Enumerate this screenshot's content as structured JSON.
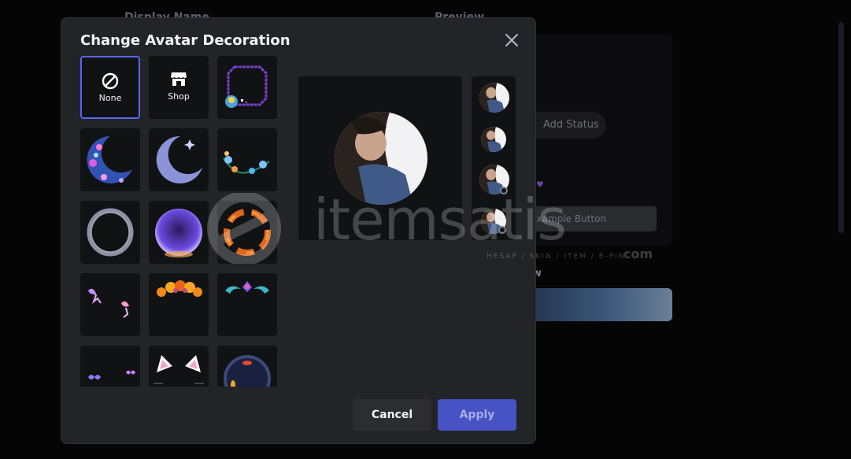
{
  "background": {
    "display_name_label": "Display Name",
    "preview_label": "Preview",
    "add_status": "Add Status",
    "example_button": "Example Button",
    "preview_word": "w"
  },
  "modal": {
    "title": "Change Avatar Decoration",
    "tiles": [
      {
        "name": "none",
        "label": "None",
        "selected": true
      },
      {
        "name": "shop",
        "label": "Shop"
      },
      {
        "name": "pixel-frame",
        "label": ""
      },
      {
        "name": "pink-crescent",
        "label": ""
      },
      {
        "name": "blue-crescent",
        "label": ""
      },
      {
        "name": "flower-vine",
        "label": ""
      },
      {
        "name": "smoke-ring",
        "label": ""
      },
      {
        "name": "purple-orb",
        "label": ""
      },
      {
        "name": "koi-ring",
        "label": ""
      },
      {
        "name": "fairies",
        "label": ""
      },
      {
        "name": "flower-crown",
        "label": ""
      },
      {
        "name": "teal-ornament",
        "label": ""
      },
      {
        "name": "butterflies",
        "label": ""
      },
      {
        "name": "cat-ears",
        "label": ""
      },
      {
        "name": "koi-pond",
        "label": ""
      }
    ],
    "cancel_label": "Cancel",
    "apply_label": "Apply"
  },
  "watermark": {
    "text": "itemsatis",
    "subtitle": "HESAP / SKIN / ITEM / E-PIN",
    "suffix": "com"
  },
  "colors": {
    "accent": "#5865f2",
    "apply_bg": "#4752c4",
    "modal_bg": "#232428",
    "tile_bg": "#111214"
  }
}
